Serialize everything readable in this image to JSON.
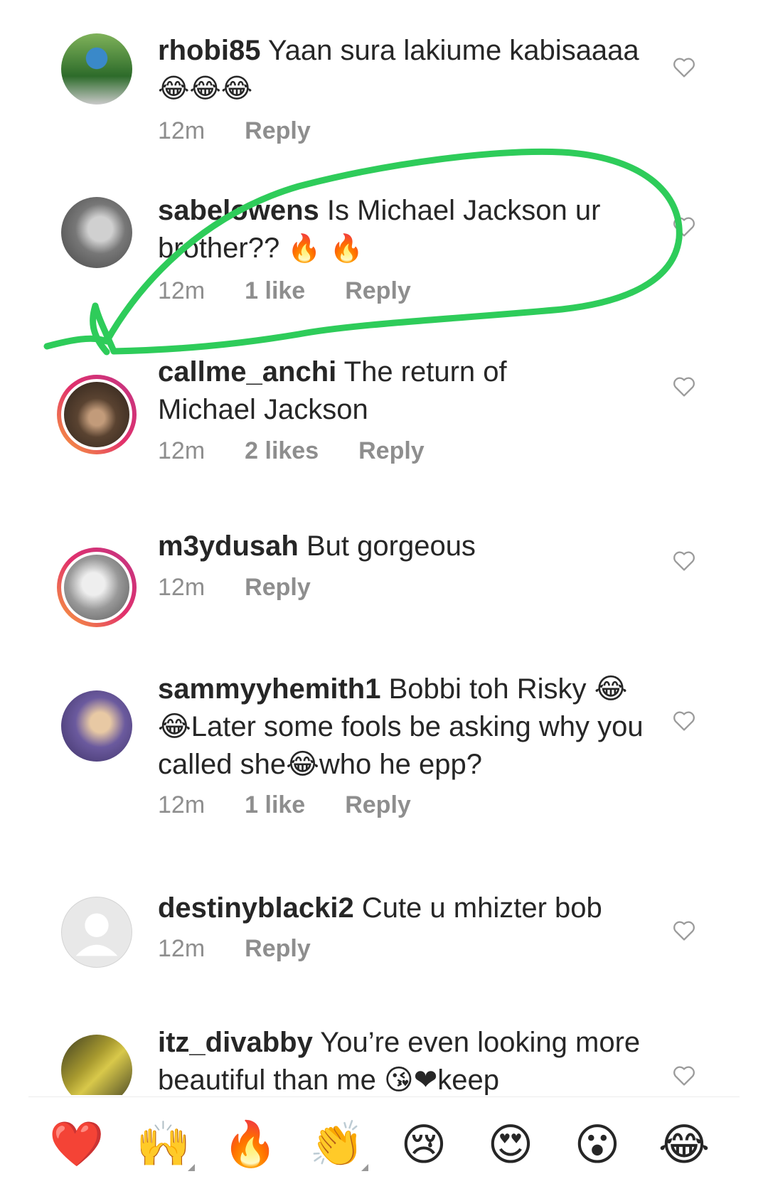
{
  "comments": [
    {
      "username": "rhobi85",
      "text": "Yaan sura lakiume kabisaaaa",
      "emojis": "😂😂😂",
      "time": "12m",
      "likes": "",
      "reply": "Reply",
      "avatar_colors": [
        "#2d6b2a",
        "#3a89c9"
      ],
      "story": false
    },
    {
      "username": "sabelowens",
      "text": "Is Michael Jackson ur brother??",
      "emojis": "🔥 🔥",
      "time": "12m",
      "likes": "1 like",
      "reply": "Reply",
      "avatar_colors": [
        "#777",
        "#bbb"
      ],
      "story": false
    },
    {
      "username": "callme_anchi",
      "text": "The return of Michael Jackson",
      "emojis": "",
      "time": "12m",
      "likes": "2 likes",
      "reply": "Reply",
      "avatar_colors": [
        "#5a4331",
        "#c29b7a"
      ],
      "story": true
    },
    {
      "username": "m3ydusah",
      "text": "But gorgeous",
      "emojis": "",
      "time": "12m",
      "likes": "",
      "reply": "Reply",
      "avatar_colors": [
        "#c9c9c9",
        "#666"
      ],
      "story": true
    },
    {
      "username": "sammyyhemith1",
      "text": "Bobbi toh Risky 😂😂Later some fools be asking why you called she😂who he epp?",
      "emojis": "",
      "time": "12m",
      "likes": "1 like",
      "reply": "Reply",
      "avatar_colors": [
        "#6b5a9e",
        "#e8c9a4"
      ],
      "story": false
    },
    {
      "username": "destinyblacki2",
      "text": "Cute u mhizter bob",
      "emojis": "",
      "time": "12m",
      "likes": "",
      "reply": "Reply",
      "avatar_colors": [
        "#dcdcdc",
        "#f4f4f4"
      ],
      "story": false
    },
    {
      "username": "itz_divabby",
      "text": "You’re even looking more beautiful than me 😘❤keep",
      "emojis": "",
      "time": "",
      "likes": "",
      "reply": "",
      "avatar_colors": [
        "#a89a2f",
        "#3b3b22"
      ],
      "story": false
    }
  ],
  "reactions": [
    "❤️",
    "🙌",
    "🔥",
    "👏",
    "😢",
    "😍",
    "😮",
    "😂"
  ],
  "annotation_color": "#2ecc5a",
  "icons": {
    "like": "heart-outline-icon"
  }
}
